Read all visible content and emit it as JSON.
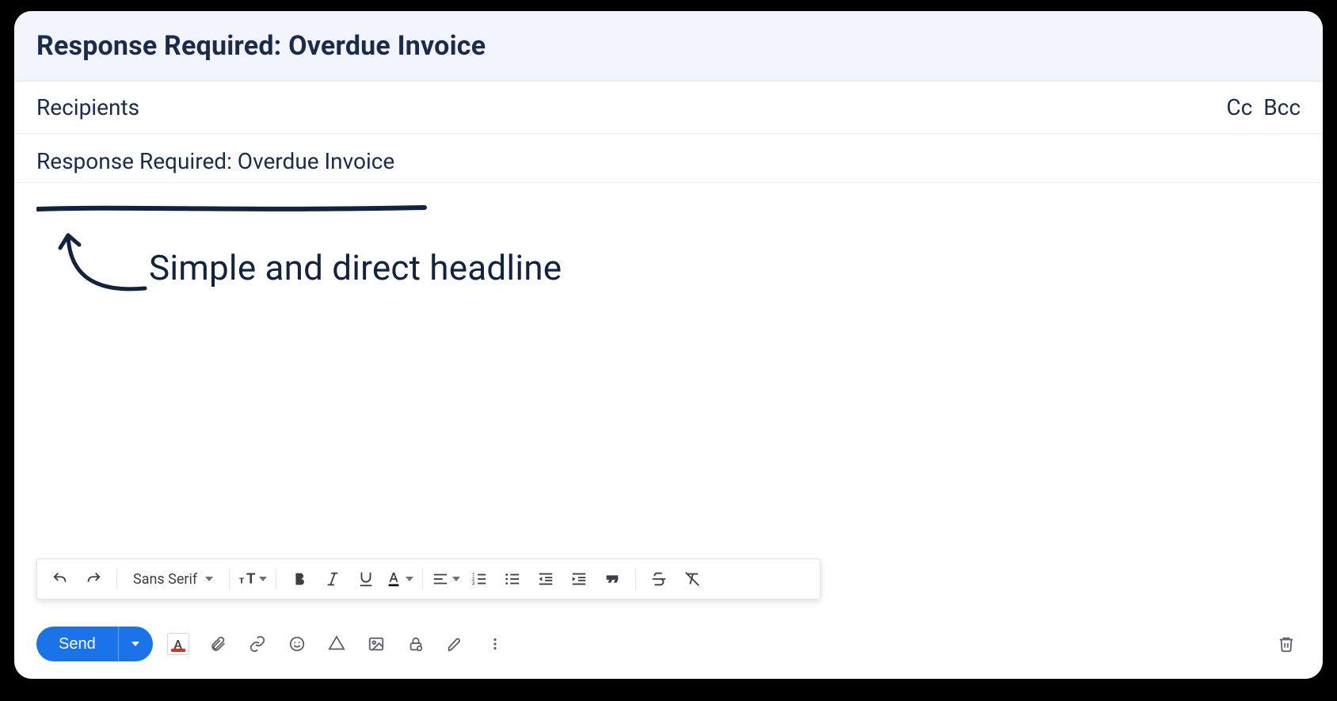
{
  "header": {
    "title": "Response Required: Overdue Invoice"
  },
  "recipients": {
    "label": "Recipients",
    "cc_label": "Cc",
    "bcc_label": "Bcc"
  },
  "subject": {
    "value": "Response Required: Overdue Invoice"
  },
  "annotation": {
    "text": "Simple and direct headline"
  },
  "format_toolbar": {
    "font_family": "Sans Serif"
  },
  "actions": {
    "send_label": "Send"
  }
}
